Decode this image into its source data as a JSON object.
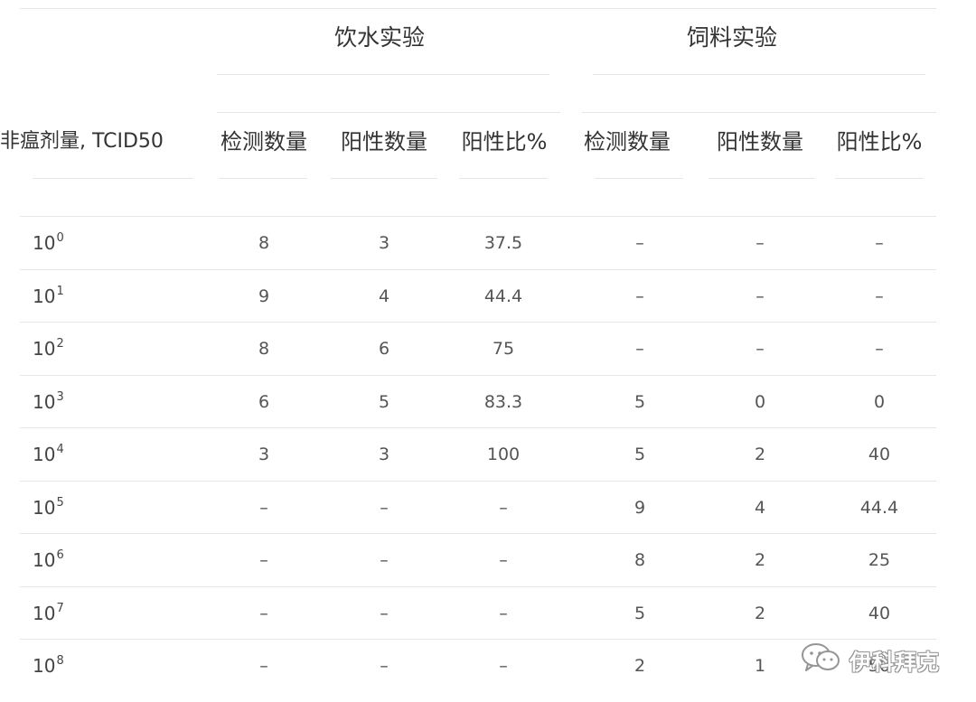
{
  "table": {
    "group_headers": {
      "drinking_water": "饮水实验",
      "feed": "饲料实验"
    },
    "dose_header": "非瘟剂量, TCID50",
    "column_headers": [
      "检测数量",
      "阳性数量",
      "阳性比%",
      "检测数量",
      "阳性数量",
      "阳性比%"
    ],
    "rows": [
      {
        "dose_base": "10",
        "dose_exp": "0",
        "cells": [
          "8",
          "3",
          "37.5",
          "–",
          "–",
          "–"
        ]
      },
      {
        "dose_base": "10",
        "dose_exp": "1",
        "cells": [
          "9",
          "4",
          "44.4",
          "–",
          "–",
          "–"
        ]
      },
      {
        "dose_base": "10",
        "dose_exp": "2",
        "cells": [
          "8",
          "6",
          "75",
          "–",
          "–",
          "–"
        ]
      },
      {
        "dose_base": "10",
        "dose_exp": "3",
        "cells": [
          "6",
          "5",
          "83.3",
          "5",
          "0",
          "0"
        ]
      },
      {
        "dose_base": "10",
        "dose_exp": "4",
        "cells": [
          "3",
          "3",
          "100",
          "5",
          "2",
          "40"
        ]
      },
      {
        "dose_base": "10",
        "dose_exp": "5",
        "cells": [
          "–",
          "–",
          "–",
          "9",
          "4",
          "44.4"
        ]
      },
      {
        "dose_base": "10",
        "dose_exp": "6",
        "cells": [
          "–",
          "–",
          "–",
          "8",
          "2",
          "25"
        ]
      },
      {
        "dose_base": "10",
        "dose_exp": "7",
        "cells": [
          "–",
          "–",
          "–",
          "5",
          "2",
          "40"
        ]
      },
      {
        "dose_base": "10",
        "dose_exp": "8",
        "cells": [
          "–",
          "–",
          "–",
          "2",
          "1",
          "50"
        ]
      }
    ]
  },
  "watermark": {
    "icon": "wechat-icon",
    "text": "伊科拜克"
  }
}
